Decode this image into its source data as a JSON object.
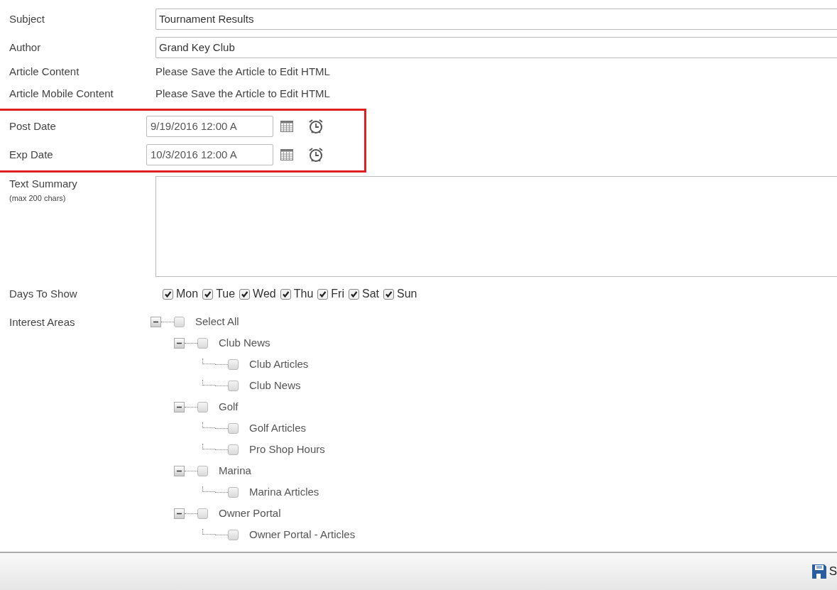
{
  "fields": [
    {
      "kind": "input",
      "label": "Subject",
      "value": "Tournament Results"
    },
    {
      "kind": "input",
      "label": "Author",
      "value": "Grand Key Club"
    },
    {
      "kind": "text",
      "label": "Article Content",
      "value": "Please Save the Article to Edit HTML"
    },
    {
      "kind": "text",
      "label": "Article Mobile Content",
      "value": "Please Save the Article to Edit HTML"
    }
  ],
  "dates": {
    "highlighted": true,
    "rows": [
      {
        "label": "Post Date",
        "value": "9/19/2016 12:00 A"
      },
      {
        "label": "Exp Date",
        "value": "10/3/2016 12:00 A"
      }
    ]
  },
  "summary": {
    "label": "Text Summary",
    "hint": "(max 200 chars)"
  },
  "days": {
    "label": "Days To Show",
    "items": [
      {
        "label": "Mon",
        "checked": true
      },
      {
        "label": "Tue",
        "checked": true
      },
      {
        "label": "Wed",
        "checked": true
      },
      {
        "label": "Thu",
        "checked": true
      },
      {
        "label": "Fri",
        "checked": true
      },
      {
        "label": "Sat",
        "checked": true
      },
      {
        "label": "Sun",
        "checked": true
      }
    ]
  },
  "interest": {
    "label": "Interest Areas",
    "tree": [
      {
        "label": "Select All",
        "checked": false,
        "expanded": true,
        "children": [
          {
            "label": "Club News",
            "checked": false,
            "expanded": true,
            "children": [
              {
                "label": "Club Articles",
                "checked": false
              },
              {
                "label": "Club News",
                "checked": false
              }
            ]
          },
          {
            "label": "Golf",
            "checked": false,
            "expanded": true,
            "children": [
              {
                "label": "Golf Articles",
                "checked": false
              },
              {
                "label": "Pro Shop Hours",
                "checked": false
              }
            ]
          },
          {
            "label": "Marina",
            "checked": false,
            "expanded": true,
            "children": [
              {
                "label": "Marina Articles",
                "checked": false
              }
            ]
          },
          {
            "label": "Owner Portal",
            "checked": false,
            "expanded": true,
            "children": [
              {
                "label": "Owner Portal - Articles",
                "checked": false
              }
            ]
          }
        ]
      }
    ]
  },
  "footer": {
    "save_label": "S"
  }
}
